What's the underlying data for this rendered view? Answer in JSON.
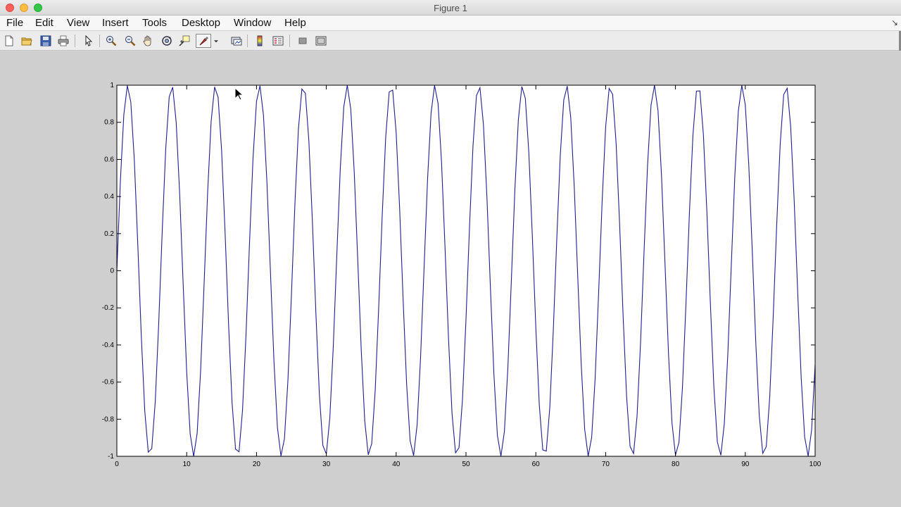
{
  "window": {
    "title": "Figure 1"
  },
  "menu": {
    "items": [
      "File",
      "Edit",
      "View",
      "Insert",
      "Tools",
      "Desktop",
      "Window",
      "Help"
    ],
    "overflow_arrow": "↘"
  },
  "toolbar": {
    "buttons": [
      "new-figure-icon",
      "open-file-icon",
      "save-icon",
      "print-icon",
      "edit-plot-arrow-icon",
      "zoom-in-icon",
      "zoom-out-icon",
      "pan-hand-icon",
      "rotate-3d-icon",
      "data-cursor-icon",
      "brush-icon",
      "brush-dropdown-icon",
      "link-plot-icon",
      "insert-colorbar-icon",
      "insert-legend-icon",
      "hide-plot-tools-icon",
      "show-plot-tools-icon"
    ]
  },
  "colors": {
    "line": "#1f1f8f",
    "axes_bg": "#ffffff",
    "figure_bg": "#cfcfcf"
  },
  "chart_data": {
    "type": "line",
    "function": "sin",
    "x_start": 0,
    "x_end": 100,
    "x_step": 0.5,
    "ylim": [
      -1,
      1
    ],
    "xlim": [
      0,
      100
    ],
    "xticks": [
      "0",
      "10",
      "20",
      "30",
      "40",
      "50",
      "60",
      "70",
      "80",
      "90",
      "100"
    ],
    "yticks": [
      "-1",
      "-0.8",
      "-0.6",
      "-0.4",
      "-0.2",
      "0",
      "0.2",
      "0.4",
      "0.6",
      "0.8",
      "1"
    ],
    "grid": false,
    "title": "",
    "xlabel": "",
    "ylabel": ""
  }
}
